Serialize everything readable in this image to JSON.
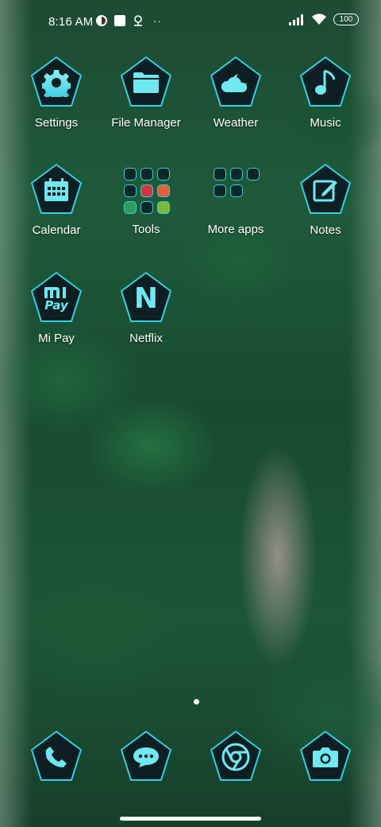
{
  "status_bar": {
    "time": "8:16 AM",
    "battery": "100",
    "overflow": "··",
    "icons": [
      "notification-badge-icon",
      "square-notification-icon",
      "vpn-key-icon",
      "signal-icon",
      "wifi-icon",
      "battery-icon"
    ]
  },
  "apps": [
    {
      "label": "Settings",
      "icon": "gear-icon"
    },
    {
      "label": "File Manager",
      "icon": "folder-icon"
    },
    {
      "label": "Weather",
      "icon": "cloud-moon-icon"
    },
    {
      "label": "Music",
      "icon": "music-note-icon"
    },
    {
      "label": "Calendar",
      "icon": "calendar-icon"
    },
    {
      "label": "Tools",
      "icon": "folder-grid"
    },
    {
      "label": "More apps",
      "icon": "folder-grid"
    },
    {
      "label": "Notes",
      "icon": "note-pencil-icon"
    },
    {
      "label": "Mi Pay",
      "icon": "mi-pay-icon",
      "logo_text": "Pay"
    },
    {
      "label": "Netflix",
      "icon": "netflix-n-icon",
      "logo_text": "N"
    }
  ],
  "dock": [
    {
      "icon": "phone-icon"
    },
    {
      "icon": "message-icon"
    },
    {
      "icon": "chrome-icon"
    },
    {
      "icon": "camera-icon"
    }
  ],
  "colors": {
    "accent": "#2fd3e6",
    "icon_fill": "#0e1f24",
    "glyph": "#6fe8f2"
  },
  "page_indicator": {
    "current": 1,
    "total": 1
  }
}
